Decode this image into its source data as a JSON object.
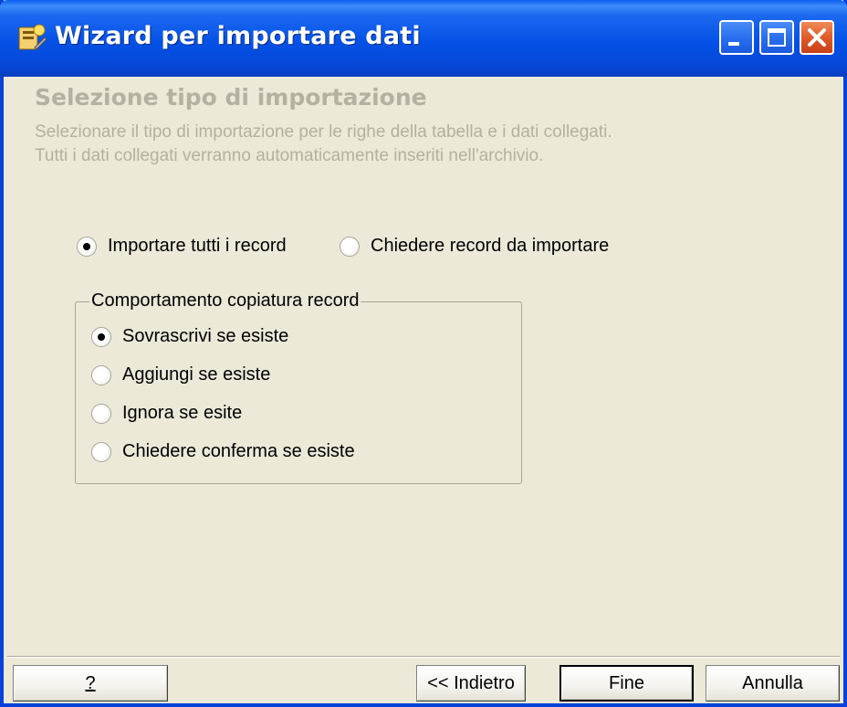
{
  "window": {
    "title": "Wizard per importare dati"
  },
  "header": {
    "heading": "Selezione tipo di importazione",
    "description_line1": "Selezionare il tipo di importazione per le righe della tabella e i dati collegati.",
    "description_line2": "Tutti i dati collegati verranno automaticamente inseriti nell'archivio."
  },
  "import_mode": {
    "options": [
      {
        "label": "Importare tutti i record",
        "selected": true
      },
      {
        "label": "Chiedere record da importare",
        "selected": false
      }
    ]
  },
  "copy_behavior": {
    "title": "Comportamento copiatura record",
    "options": [
      {
        "label": "Sovrascrivi se esiste",
        "selected": true
      },
      {
        "label": "Aggiungi se esiste",
        "selected": false
      },
      {
        "label": "Ignora se esite",
        "selected": false
      },
      {
        "label": "Chiedere conferma se esiste",
        "selected": false
      }
    ]
  },
  "buttons": {
    "help": "?",
    "back": "<< Indietro",
    "finish": "Fine",
    "cancel": "Annulla"
  },
  "icons": {
    "app": "wizard-app-icon",
    "minimize": "minimize-icon",
    "maximize": "maximize-icon",
    "close": "close-icon",
    "radio": "radio-dot-icon"
  },
  "colors": {
    "titlebar": "#0551e6",
    "background": "#ece9d8",
    "disabled_text": "#b4b0a2"
  }
}
